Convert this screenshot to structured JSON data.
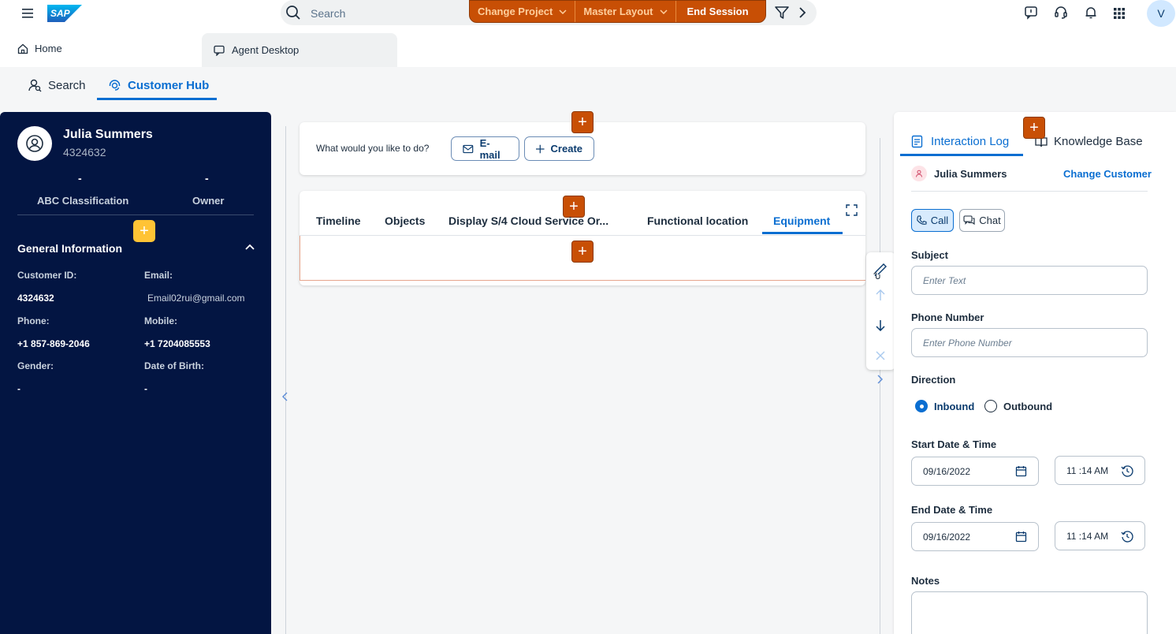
{
  "shell": {
    "logo_text": "SAP",
    "search_placeholder": "Search",
    "actions": [
      "Change Project",
      "Master Layout",
      "End Session"
    ],
    "user_initial": "V",
    "accent_orange": "#c84f05"
  },
  "tabs": {
    "home": "Home",
    "agent_desktop": "Agent Desktop"
  },
  "subtabs": {
    "search": "Search",
    "customer_hub": "Customer Hub"
  },
  "customer": {
    "name": "Julia Summers",
    "id": "4324632",
    "abc_value": "-",
    "abc_label": "ABC Classification",
    "owner_value": "-",
    "owner_label": "Owner",
    "add_symbol": "+",
    "section_title": "General Information",
    "fields": {
      "customer_id_label": "Customer ID:",
      "customer_id_value": "4324632",
      "email_label": "Email:",
      "email_value": "Email02rui@gmail.com",
      "phone_label": "Phone:",
      "phone_value": "+1 857-869-2046",
      "mobile_label": "Mobile:",
      "mobile_value": "+1 7204085553",
      "gender_label": "Gender:",
      "gender_value": "-",
      "dob_label": "Date of Birth:",
      "dob_value": "-"
    }
  },
  "center": {
    "prompt": "What would you like to do?",
    "email_button": "E-mail",
    "create_button": "Create",
    "add_symbol": "+",
    "tabs": [
      "Timeline",
      "Objects",
      "Display S/4 Cloud Service Or...",
      "Functional location",
      "Equipment"
    ],
    "active_tab": "Equipment"
  },
  "right": {
    "tab_interaction_log": "Interaction Log",
    "tab_knowledge_base": "Knowledge Base",
    "customer_name": "Julia Summers",
    "change_customer": "Change Customer",
    "call_button": "Call",
    "chat_button": "Chat",
    "subject_label": "Subject",
    "subject_placeholder": "Enter Text",
    "phone_label": "Phone Number",
    "phone_placeholder": "Enter Phone Number",
    "direction_label": "Direction",
    "direction_inbound": "Inbound",
    "direction_outbound": "Outbound",
    "start_label": "Start Date & Time",
    "start_date": "09/16/2022",
    "start_time": "11 :14  AM",
    "end_label": "End Date & Time",
    "end_date": "09/16/2022",
    "end_time": "11 :14  AM",
    "notes_label": "Notes"
  }
}
